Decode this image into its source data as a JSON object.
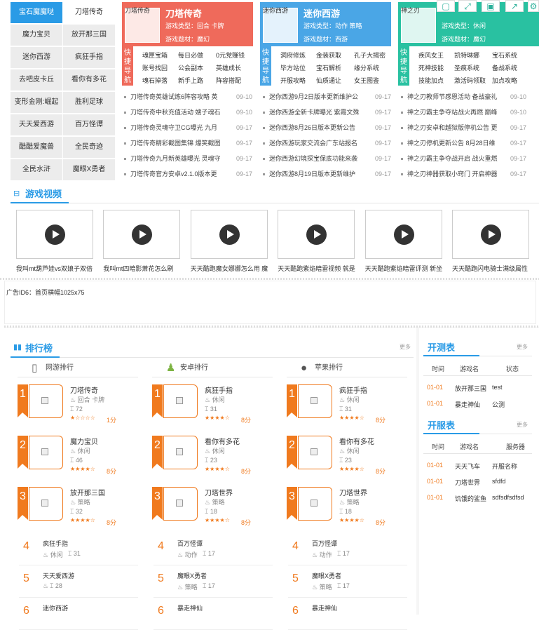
{
  "games": [
    "宝石魔魔哒",
    "刀塔传奇",
    "魔力宝贝",
    "放开那三国",
    "迷你西游",
    "疯狂手指",
    "去吧皮卡丘",
    "看你有多花",
    "变形金刚:崛起",
    "胜利足球",
    "天天爱西游",
    "百万怪谭",
    "酷酷爱魔兽",
    "全民奇迹",
    "全民水浒",
    "魔眼X勇者"
  ],
  "cards": [
    {
      "tag": "刀塔传奇",
      "title": "刀塔传奇",
      "line1": "游戏类型：回合 卡牌",
      "line2": "游戏题材：魔幻",
      "quick_label": "快捷导航",
      "links": [
        "魂匣宝箱",
        "每日必做",
        "0元党赚钱",
        "账号找回",
        "公会副本",
        "英雄成长",
        "魂石掉落",
        "新手上路",
        "阵容搭配"
      ],
      "news": [
        {
          "t": "刀塔传奇英雄试炼6阵容攻略 英",
          "d": "09-10"
        },
        {
          "t": "刀塔传奇中秋充值活动 嫂子魂石",
          "d": "09-10"
        },
        {
          "t": "刀塔传奇灵魂守卫CG曝光 九月",
          "d": "09-17"
        },
        {
          "t": "刀塔传奇精彩截图集锦 爆笑截图",
          "d": "09-17"
        },
        {
          "t": "刀塔传奇九月新英雄曝光 灵魂守",
          "d": "09-17"
        },
        {
          "t": "刀塔传奇官方安卓v2.1.0版本更",
          "d": "09-17"
        }
      ]
    },
    {
      "tag": "迷你西游",
      "title": "迷你西游",
      "line1": "游戏类型：动作 策略",
      "line2": "游戏题材：西游",
      "quick_label": "快捷导航",
      "links": [
        "洞府修炼",
        "金装获取",
        "孔子大揭密",
        "毕方站位",
        "宝石解析",
        "缘分系统",
        "开服攻略",
        "仙质通让",
        "女王图鉴"
      ],
      "news": [
        {
          "t": "迷你西游9月2日版本更新维护公",
          "d": "09-17"
        },
        {
          "t": "迷你西游全新卡牌曝光 紫霞文殊",
          "d": "09-17"
        },
        {
          "t": "迷你西游8月26日版本更新公告",
          "d": "09-17"
        },
        {
          "t": "迷你西游玩家交流会广东站报名",
          "d": "09-17"
        },
        {
          "t": "迷你西游幻境探宝保底功能来袭",
          "d": "09-17"
        },
        {
          "t": "迷你西游8月19日版本更新维护",
          "d": "09-17"
        }
      ]
    },
    {
      "tag": "神之刃",
      "title": "",
      "line1": "游戏类型：休闲",
      "line2": "游戏题材：魔幻",
      "quick_label": "快捷导航",
      "links": [
        "疾风女王",
        "凯特琳娜",
        "宝石系统",
        "死神技能",
        "圣痕系统",
        "备战系统",
        "技能加点",
        "激活码领取",
        "加点攻略"
      ],
      "news": [
        {
          "t": "神之刃教师节感恩活动 备战豪礼",
          "d": "09-10"
        },
        {
          "t": "神之刃霸主争夺站战火再燃 巅峰",
          "d": "09-10"
        },
        {
          "t": "神之刃安卓和越狱版停机公告 更",
          "d": "09-17"
        },
        {
          "t": "神之刃停机更新公告 8月28日维",
          "d": "09-17"
        },
        {
          "t": "神之刃霸主争夺战开启 战火重燃",
          "d": "09-17"
        },
        {
          "t": "神之刃神器获取小窍门 开启神器",
          "d": "09-17"
        }
      ]
    }
  ],
  "videos": {
    "title": "游戏视频",
    "items": [
      "我叫mt葫芦娃vs双娘子双倍",
      "我叫mt四暗影萧花怎么刷",
      "天天酷跑魔女娜娜怎么用 魔",
      "天天酷跑紫焰暗雷视频 就是",
      "天天酷跑紫焰暗雷评测 新坐",
      "天天酷跑闪电骑士满级属性"
    ]
  },
  "ad": "广告ID6：首页横幅1025x75",
  "rank": {
    "title": "排行榜",
    "more": "更多",
    "columns": [
      {
        "label": "网游排行",
        "icon": "phone-icon",
        "top": [
          {
            "n": "1",
            "name": "刀塔传奇",
            "type": "回合 卡牌",
            "count": "72",
            "stars": 1,
            "score": "1分"
          },
          {
            "n": "2",
            "name": "魔力宝贝",
            "type": "休闲",
            "count": "46",
            "stars": 4,
            "score": "8分"
          },
          {
            "n": "3",
            "name": "放开那三国",
            "type": "策略",
            "count": "32",
            "stars": 4,
            "score": "8分"
          }
        ],
        "rest": [
          {
            "n": "4",
            "name": "疯狂手指",
            "type": "休闲",
            "count": "31"
          },
          {
            "n": "5",
            "name": "天天爱西游",
            "type": "",
            "count": "28"
          },
          {
            "n": "6",
            "name": "迷你西游",
            "type": "",
            "count": ""
          }
        ]
      },
      {
        "label": "安卓排行",
        "icon": "android-icon",
        "top": [
          {
            "n": "1",
            "name": "疯狂手指",
            "type": "休闲",
            "count": "31",
            "stars": 4,
            "score": "8分"
          },
          {
            "n": "2",
            "name": "看你有多花",
            "type": "休闲",
            "count": "23",
            "stars": 4,
            "score": "8分"
          },
          {
            "n": "3",
            "name": "刀塔世界",
            "type": "策略",
            "count": "18",
            "stars": 4,
            "score": "8分"
          }
        ],
        "rest": [
          {
            "n": "4",
            "name": "百万怪谭",
            "type": "动作",
            "count": "17"
          },
          {
            "n": "5",
            "name": "魔眼X勇者",
            "type": "策略",
            "count": "17"
          },
          {
            "n": "6",
            "name": "暴走神仙",
            "type": "",
            "count": ""
          }
        ]
      },
      {
        "label": "苹果排行",
        "icon": "apple-icon",
        "top": [
          {
            "n": "1",
            "name": "疯狂手指",
            "type": "休闲",
            "count": "31",
            "stars": 4,
            "score": "8分"
          },
          {
            "n": "2",
            "name": "看你有多花",
            "type": "休闲",
            "count": "23",
            "stars": 4,
            "score": "8分"
          },
          {
            "n": "3",
            "name": "刀塔世界",
            "type": "策略",
            "count": "18",
            "stars": 4,
            "score": "8分"
          }
        ],
        "rest": [
          {
            "n": "4",
            "name": "百万怪谭",
            "type": "动作",
            "count": "17"
          },
          {
            "n": "5",
            "name": "魔眼X勇者",
            "type": "策略",
            "count": "17"
          },
          {
            "n": "6",
            "name": "暴走神仙",
            "type": "",
            "count": ""
          }
        ]
      }
    ]
  },
  "kaice": {
    "title": "开测表",
    "more": "更多",
    "headers": [
      "时间",
      "游戏名",
      "状态"
    ],
    "rows": [
      [
        "01-01",
        "放开那三国",
        "test"
      ],
      [
        "01-01",
        "暴走神仙",
        "公测"
      ]
    ]
  },
  "kaifu": {
    "title": "开服表",
    "more": "更多",
    "headers": [
      "时间",
      "游戏名",
      "服务器"
    ],
    "rows": [
      [
        "01-01",
        "天天飞车",
        "开服名称"
      ],
      [
        "01-01",
        "刀塔世界",
        "sfdfd"
      ],
      [
        "01-01",
        "饥饿的鲨鱼",
        "sdfsdfsdfsd"
      ]
    ]
  },
  "colors": {
    "blue": "#2a9be6",
    "red": "#ef6a5b",
    "sky": "#4aa6e6",
    "teal": "#29c1a1",
    "orange": "#f07a1e"
  }
}
